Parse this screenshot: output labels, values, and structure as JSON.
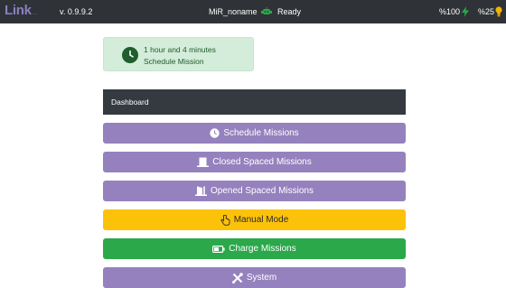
{
  "topbar": {
    "logo_main": "Link",
    "logo_suffix": "....",
    "version": "v. 0.9.9.2",
    "robot_name": "MiR_noname",
    "status": "Ready",
    "battery_pct": "%100",
    "bulb_pct": "%25",
    "colors": {
      "background": "#2f3236",
      "robot_icon": "#2aa84a",
      "battery_icon": "#2aa84a",
      "bulb_icon": "#f0b400"
    },
    "icons": {
      "robot": "robot-icon",
      "battery": "lightning-icon",
      "bulb": "lightbulb-icon"
    }
  },
  "schedule_card": {
    "time": "1 hour and 4 minutes",
    "label": "Schedule Mission",
    "icon": "clock-icon"
  },
  "dashboard": {
    "title": "Dashboard",
    "buttons": [
      {
        "label": "Schedule Missions",
        "icon": "clock-icon",
        "color": "#9581bd"
      },
      {
        "label": "Closed Spaced Missions",
        "icon": "closed-door-icon",
        "color": "#9581bd"
      },
      {
        "label": "Opened Spaced Missions",
        "icon": "open-door-icon",
        "color": "#9581bd"
      },
      {
        "label": "Manual Mode",
        "icon": "hand-pointer-icon",
        "color": "#fcc20a"
      },
      {
        "label": "Charge Missions",
        "icon": "battery-icon",
        "color": "#2aa84a"
      },
      {
        "label": "System",
        "icon": "tools-icon",
        "color": "#9581bd"
      }
    ]
  }
}
